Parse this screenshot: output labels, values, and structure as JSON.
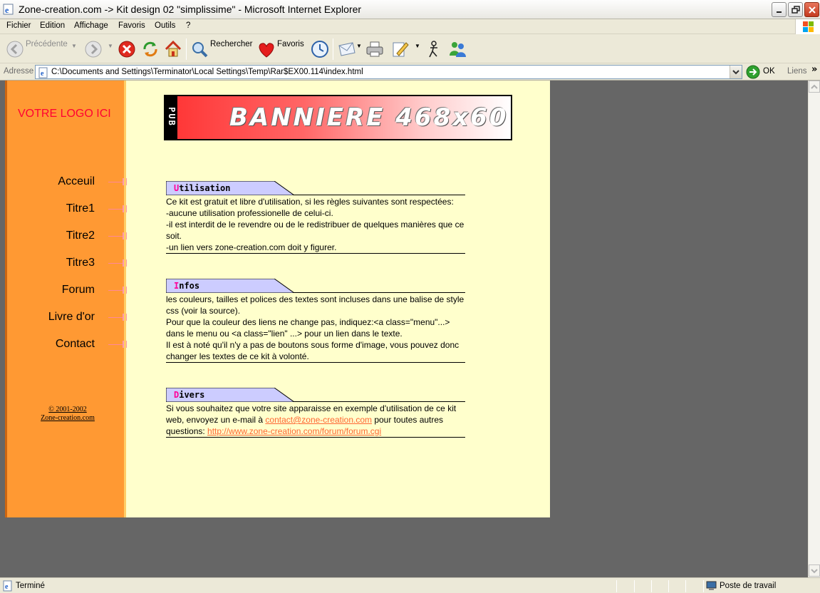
{
  "window": {
    "title": "Zone-creation.com -> Kit design 02 \"simplissime\" - Microsoft Internet Explorer"
  },
  "menu": [
    "Fichier",
    "Edition",
    "Affichage",
    "Favoris",
    "Outils",
    "?"
  ],
  "toolbar": {
    "back": "Précédente",
    "search": "Rechercher",
    "favorites": "Favoris"
  },
  "address": {
    "label": "Adresse",
    "value": "C:\\Documents and Settings\\Terminator\\Local Settings\\Temp\\Rar$EX00.114\\index.html",
    "go": "OK",
    "links": "Liens"
  },
  "site": {
    "logo": "VOTRE LOGO ICI",
    "banner_side": "PUB",
    "banner_text": "BANNIERE 468x60",
    "nav": [
      "Acceuil",
      "Titre1",
      "Titre2",
      "Titre3",
      "Forum",
      "Livre d'or",
      "Contact"
    ],
    "copyright_1": "© 2001-2002",
    "copyright_2": "Zone-creation.com",
    "sections": [
      {
        "first": "U",
        "rest": "tilisation",
        "lines": [
          "Ce kit est gratuit et libre d'utilisation, si les règles suivantes sont respectées:",
          "-aucune utilisation professionelle de celui-ci.",
          "-il est interdit de le revendre ou de le redistribuer de quelques manières que ce soit.",
          "-un lien vers zone-creation.com doit y figurer."
        ]
      },
      {
        "first": "I",
        "rest": "nfos",
        "lines": [
          "les couleurs, tailles et polices des textes sont incluses dans une balise de style css (voir la source).",
          "Pour que la couleur des liens ne change pas, indiquez:<a class=\"menu\"...> dans le menu ou <a class=\"lien\" ...> pour un lien dans le texte.",
          "Il est à noté qu'il n'y a pas de boutons sous forme d'image, vous pouvez donc changer les textes de ce kit à volonté."
        ]
      },
      {
        "first": "D",
        "rest": "ivers",
        "text_1": "Si vous souhaitez que votre site apparaisse en exemple d'utilisation de ce kit web, envoyez un e-mail à ",
        "email": "contact@zone-creation.com",
        "text_2": " pour toutes autres questions: ",
        "forum_url": "http://www.zone-creation.com/forum/forum.cgi"
      }
    ]
  },
  "status": {
    "text": "Terminé",
    "zone": "Poste de travail"
  },
  "colors": {
    "sidebar": "#ff9933",
    "page_bg": "#ffffcc",
    "logo": "#ff0033",
    "link": "#ff6633",
    "section_tab": "#ccccff",
    "accent_letter": "#ff0099"
  }
}
